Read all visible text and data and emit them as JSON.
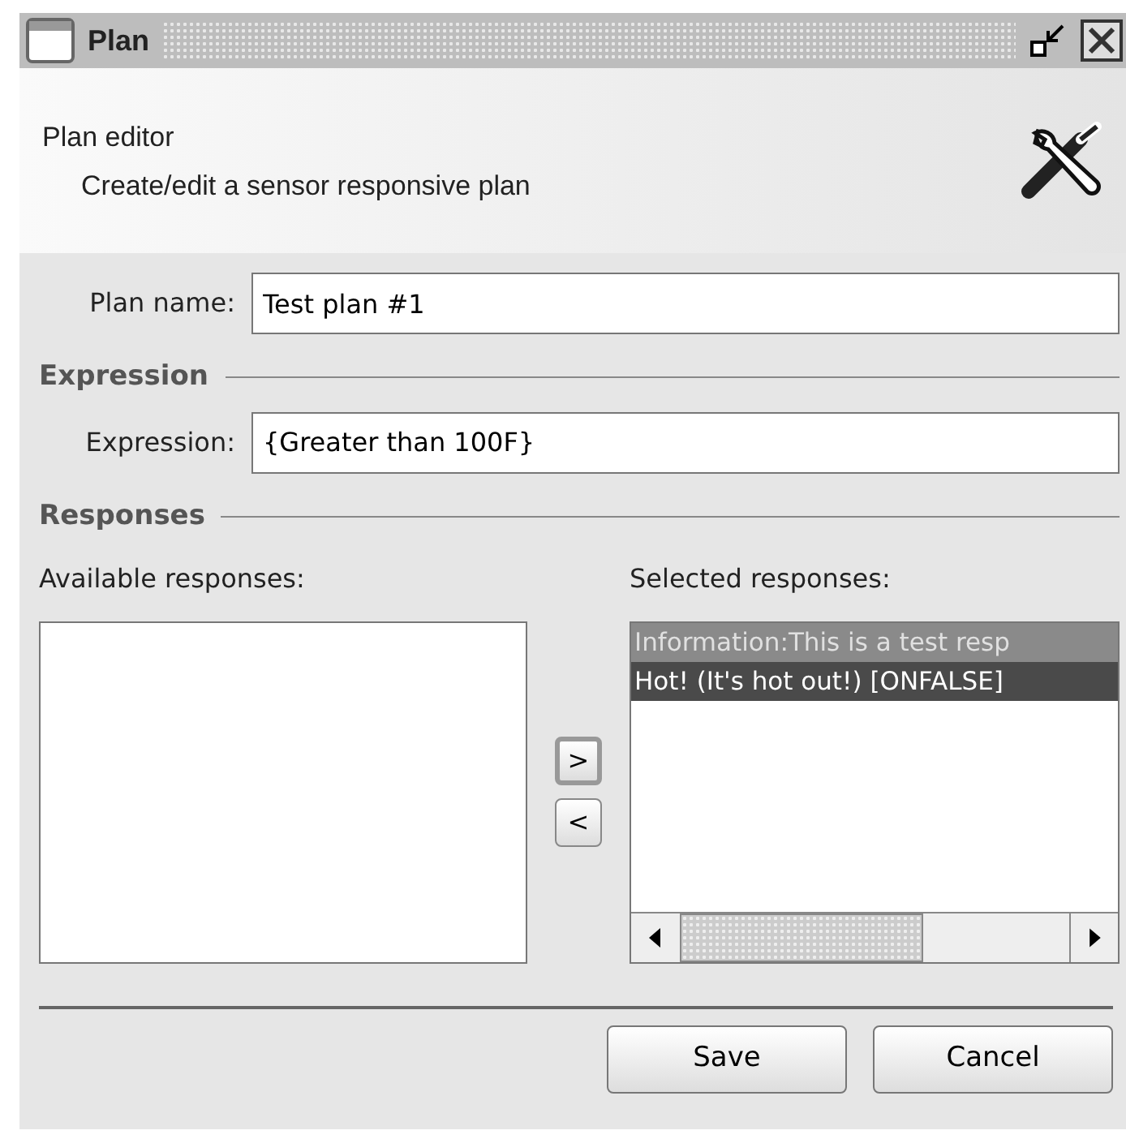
{
  "window": {
    "title": "Plan"
  },
  "header": {
    "title": "Plan editor",
    "subtitle": "Create/edit a sensor responsive plan"
  },
  "plan_name": {
    "label": "Plan name:",
    "value": "Test plan #1"
  },
  "expression_section": {
    "heading": "Expression",
    "label": "Expression:",
    "value": "{Greater than 100F}"
  },
  "responses_section": {
    "heading": "Responses",
    "available": {
      "label": "Available responses:"
    },
    "selected": {
      "label": "Selected responses:",
      "items": [
        {
          "text": "Information:This is a test resp",
          "selected": true,
          "focused": false
        },
        {
          "text": "Hot! (It's hot out!) [ONFALSE]",
          "selected": true,
          "focused": true
        }
      ]
    },
    "move_buttons": [
      ">",
      "<"
    ]
  },
  "buttons": [
    "Save",
    "Cancel"
  ]
}
